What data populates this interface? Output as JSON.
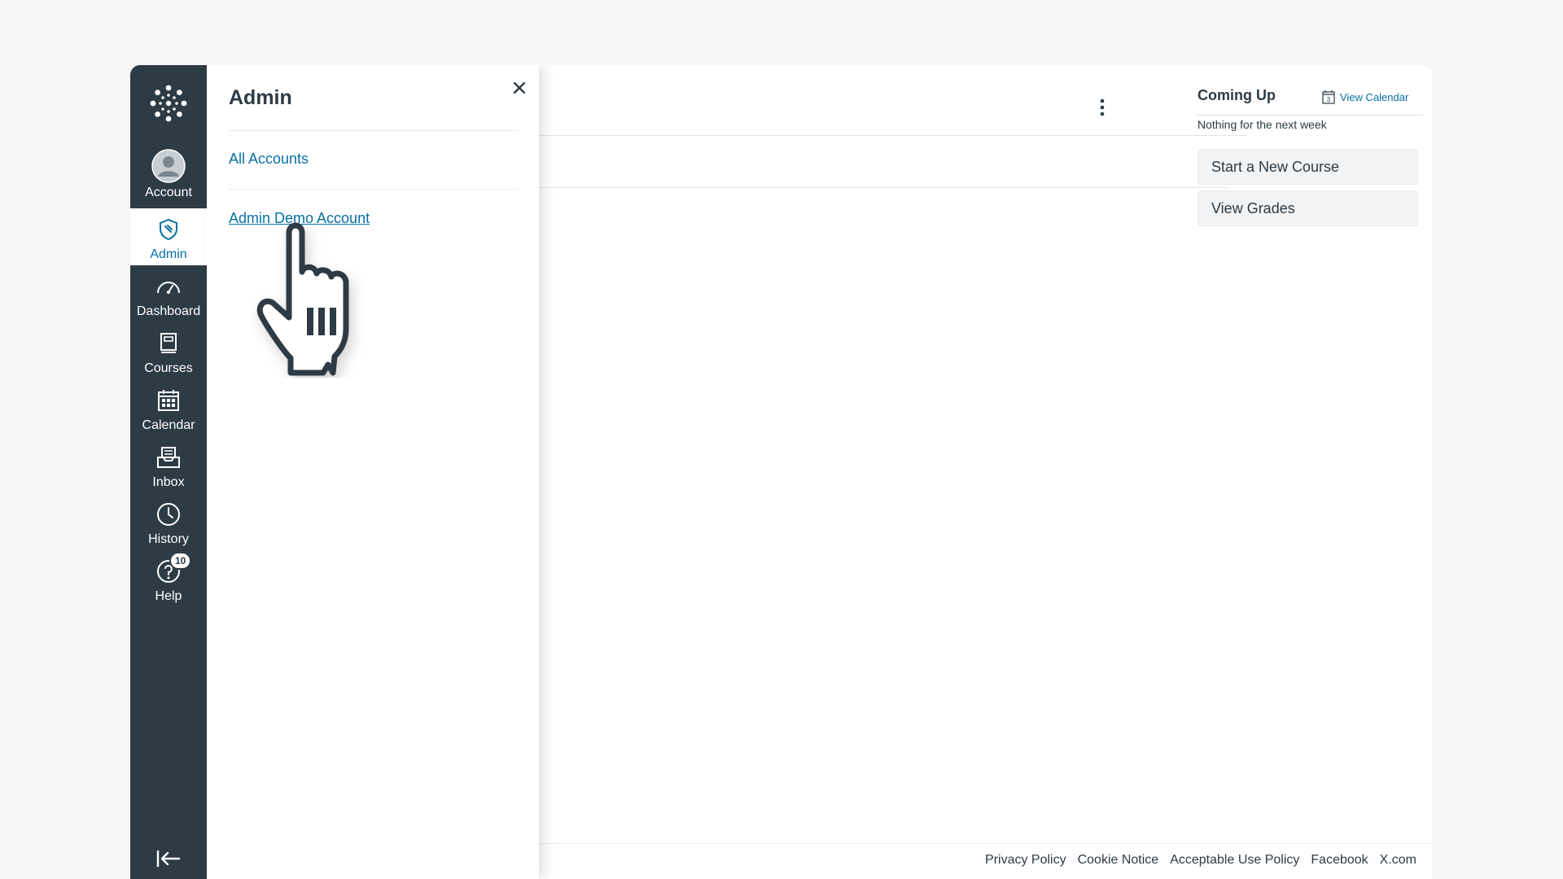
{
  "nav": {
    "items": [
      {
        "key": "account",
        "label": "Account"
      },
      {
        "key": "admin",
        "label": "Admin"
      },
      {
        "key": "dashboard",
        "label": "Dashboard"
      },
      {
        "key": "courses",
        "label": "Courses"
      },
      {
        "key": "calendar",
        "label": "Calendar"
      },
      {
        "key": "inbox",
        "label": "Inbox"
      },
      {
        "key": "history",
        "label": "History"
      },
      {
        "key": "help",
        "label": "Help"
      }
    ],
    "help_badge": "10",
    "active": "admin"
  },
  "tray": {
    "title": "Admin",
    "links": [
      {
        "label": "All Accounts"
      },
      {
        "label": "Admin Demo Account"
      }
    ]
  },
  "sidebar": {
    "coming_up_title": "Coming Up",
    "view_calendar": "View Calendar",
    "calendar_icon_day": "3",
    "nothing_text": "Nothing for the next week",
    "buttons": [
      {
        "label": "Start a New Course"
      },
      {
        "label": "View Grades"
      }
    ]
  },
  "footer": {
    "links": [
      "Privacy Policy",
      "Cookie Notice",
      "Acceptable Use Policy",
      "Facebook",
      "X.com"
    ]
  },
  "colors": {
    "nav_bg": "#2d3b45",
    "link": "#0770a3",
    "text": "#2d3b45"
  }
}
